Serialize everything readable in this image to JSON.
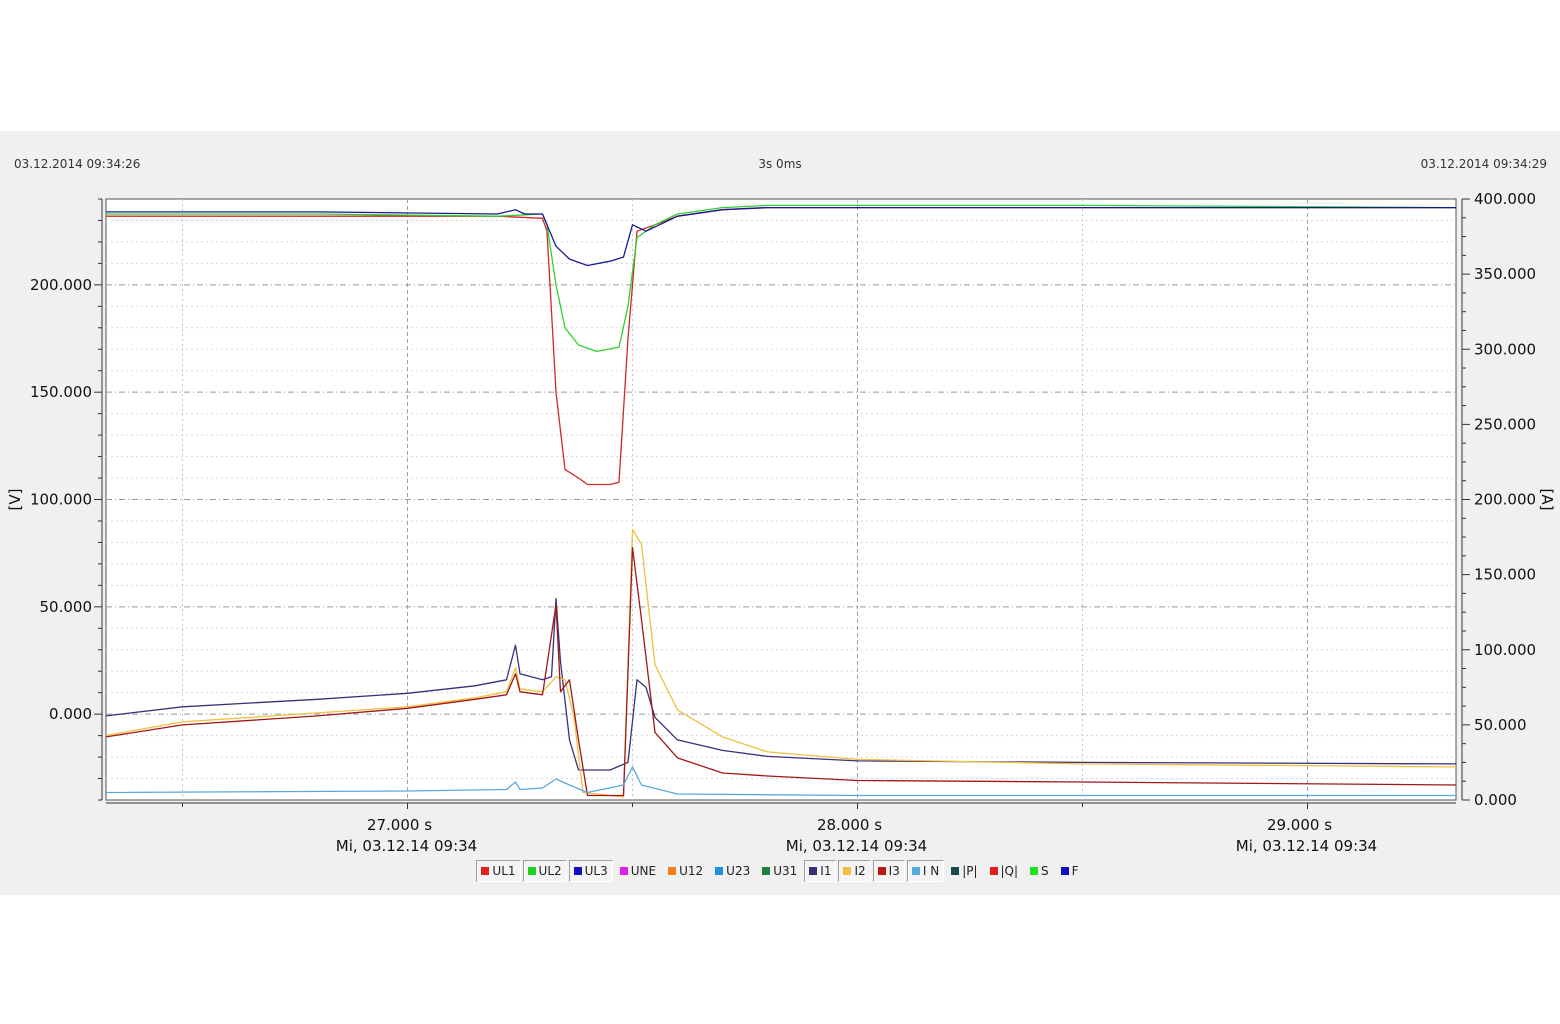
{
  "header": {
    "start_time": "03.12.2014 09:34:26",
    "duration": "3s 0ms",
    "end_time": "03.12.2014 09:34:29"
  },
  "chart_data": {
    "type": "line",
    "title": "",
    "left_axis": {
      "label": "[V]",
      "range": [
        -40,
        240
      ],
      "tick_values": [
        0,
        50,
        100,
        150,
        200
      ],
      "tick_labels": [
        "0.000",
        "50.000",
        "100.000",
        "150.000",
        "200.000"
      ]
    },
    "right_axis": {
      "label": "[A]",
      "range": [
        0,
        400
      ],
      "tick_values": [
        0,
        50,
        100,
        150,
        200,
        250,
        300,
        350,
        400
      ],
      "tick_labels": [
        "0.000",
        "50.000",
        "100.000",
        "150.000",
        "200.000",
        "250.000",
        "300.000",
        "350.000",
        "400.000"
      ]
    },
    "x_axis": {
      "unit": "s",
      "range": [
        26.33,
        29.33
      ],
      "ticks": [
        {
          "value": 27.0,
          "label1": "27.000 s",
          "label2": "Mi, 03.12.14 09:34"
        },
        {
          "value": 28.0,
          "label1": "28.000 s",
          "label2": "Mi, 03.12.14 09:34"
        },
        {
          "value": 29.0,
          "label1": "29.000 s",
          "label2": "Mi, 03.12.14 09:34"
        }
      ],
      "minor_grid": [
        26.5,
        27.5,
        28.5
      ]
    },
    "grid": true,
    "legend_position": "bottom",
    "series": [
      {
        "name": "UL1",
        "axis": "left",
        "color": "#d02828",
        "points": [
          [
            26.33,
            232
          ],
          [
            26.8,
            232
          ],
          [
            27.2,
            232
          ],
          [
            27.3,
            231
          ],
          [
            27.31,
            225
          ],
          [
            27.33,
            150
          ],
          [
            27.35,
            114
          ],
          [
            27.38,
            110
          ],
          [
            27.4,
            107
          ],
          [
            27.45,
            107
          ],
          [
            27.47,
            108
          ],
          [
            27.49,
            175
          ],
          [
            27.51,
            225
          ],
          [
            27.55,
            228
          ],
          [
            27.6,
            232
          ],
          [
            27.7,
            235
          ],
          [
            27.8,
            236
          ],
          [
            28.0,
            236
          ],
          [
            29.33,
            236
          ]
        ]
      },
      {
        "name": "UL2",
        "axis": "left",
        "color": "#30d030",
        "points": [
          [
            26.33,
            233
          ],
          [
            26.8,
            233
          ],
          [
            27.2,
            232
          ],
          [
            27.3,
            233
          ],
          [
            27.31,
            228
          ],
          [
            27.33,
            200
          ],
          [
            27.35,
            180
          ],
          [
            27.38,
            172
          ],
          [
            27.42,
            169
          ],
          [
            27.47,
            171
          ],
          [
            27.49,
            190
          ],
          [
            27.51,
            222
          ],
          [
            27.55,
            228
          ],
          [
            27.6,
            233
          ],
          [
            27.7,
            236
          ],
          [
            27.8,
            237
          ],
          [
            28.0,
            237
          ],
          [
            28.5,
            237
          ],
          [
            29.33,
            236
          ]
        ]
      },
      {
        "name": "UL3",
        "axis": "left",
        "color": "#1a1a90",
        "points": [
          [
            26.33,
            234
          ],
          [
            26.8,
            234
          ],
          [
            27.2,
            233
          ],
          [
            27.24,
            235
          ],
          [
            27.26,
            233
          ],
          [
            27.3,
            233
          ],
          [
            27.31,
            228
          ],
          [
            27.33,
            218
          ],
          [
            27.36,
            212
          ],
          [
            27.4,
            209
          ],
          [
            27.45,
            211
          ],
          [
            27.48,
            213
          ],
          [
            27.5,
            228
          ],
          [
            27.53,
            225
          ],
          [
            27.55,
            227
          ],
          [
            27.6,
            232
          ],
          [
            27.7,
            235
          ],
          [
            27.8,
            236
          ],
          [
            28.0,
            236
          ],
          [
            29.33,
            236
          ]
        ]
      }
    ],
    "current_series": [
      {
        "name": "I1",
        "axis": "right",
        "color": "#3c2f7a",
        "points": [
          [
            26.33,
            56
          ],
          [
            26.5,
            62
          ],
          [
            26.8,
            67
          ],
          [
            27.0,
            71
          ],
          [
            27.15,
            76
          ],
          [
            27.22,
            80
          ],
          [
            27.24,
            103
          ],
          [
            27.25,
            84
          ],
          [
            27.3,
            80
          ],
          [
            27.32,
            82
          ],
          [
            27.33,
            134
          ],
          [
            27.34,
            92
          ],
          [
            27.36,
            40
          ],
          [
            27.38,
            20
          ],
          [
            27.45,
            20
          ],
          [
            27.49,
            25
          ],
          [
            27.51,
            80
          ],
          [
            27.53,
            75
          ],
          [
            27.55,
            55
          ],
          [
            27.6,
            40
          ],
          [
            27.7,
            33
          ],
          [
            27.8,
            29
          ],
          [
            28.0,
            26
          ],
          [
            28.5,
            25
          ],
          [
            29.33,
            24
          ]
        ]
      },
      {
        "name": "I2",
        "axis": "right",
        "color": "#f0c040",
        "points": [
          [
            26.33,
            43
          ],
          [
            26.5,
            52
          ],
          [
            26.8,
            58
          ],
          [
            27.0,
            62
          ],
          [
            27.15,
            68
          ],
          [
            27.22,
            72
          ],
          [
            27.24,
            88
          ],
          [
            27.25,
            74
          ],
          [
            27.3,
            72
          ],
          [
            27.33,
            82
          ],
          [
            27.35,
            80
          ],
          [
            27.37,
            55
          ],
          [
            27.39,
            5
          ],
          [
            27.48,
            2
          ],
          [
            27.5,
            180
          ],
          [
            27.52,
            170
          ],
          [
            27.55,
            90
          ],
          [
            27.6,
            60
          ],
          [
            27.7,
            42
          ],
          [
            27.8,
            32
          ],
          [
            28.0,
            27
          ],
          [
            28.5,
            24
          ],
          [
            29.33,
            22
          ]
        ]
      },
      {
        "name": "I3",
        "axis": "right",
        "color": "#a01818",
        "points": [
          [
            26.33,
            42
          ],
          [
            26.5,
            50
          ],
          [
            26.8,
            56
          ],
          [
            27.0,
            61
          ],
          [
            27.15,
            67
          ],
          [
            27.22,
            70
          ],
          [
            27.24,
            84
          ],
          [
            27.25,
            72
          ],
          [
            27.3,
            70
          ],
          [
            27.33,
            130
          ],
          [
            27.34,
            72
          ],
          [
            27.36,
            80
          ],
          [
            27.38,
            40
          ],
          [
            27.4,
            3
          ],
          [
            27.48,
            3
          ],
          [
            27.5,
            168
          ],
          [
            27.52,
            120
          ],
          [
            27.55,
            45
          ],
          [
            27.6,
            28
          ],
          [
            27.7,
            18
          ],
          [
            27.8,
            16
          ],
          [
            28.0,
            13
          ],
          [
            28.5,
            12
          ],
          [
            29.33,
            10
          ]
        ]
      },
      {
        "name": "I N",
        "axis": "right",
        "color": "#5aa8e0",
        "points": [
          [
            26.33,
            5
          ],
          [
            27.0,
            6
          ],
          [
            27.22,
            7
          ],
          [
            27.24,
            12
          ],
          [
            27.25,
            7
          ],
          [
            27.3,
            8
          ],
          [
            27.33,
            14
          ],
          [
            27.36,
            10
          ],
          [
            27.4,
            5
          ],
          [
            27.48,
            10
          ],
          [
            27.5,
            22
          ],
          [
            27.52,
            10
          ],
          [
            27.6,
            4
          ],
          [
            28.0,
            3
          ],
          [
            29.33,
            3
          ]
        ]
      }
    ]
  },
  "legend": [
    {
      "label": "UL1",
      "color": "#e02020",
      "active": true
    },
    {
      "label": "UL2",
      "color": "#20d020",
      "active": true
    },
    {
      "label": "UL3",
      "color": "#1010c0",
      "active": true
    },
    {
      "label": "UNE",
      "color": "#e020e0",
      "active": false
    },
    {
      "label": "U12",
      "color": "#f08020",
      "active": false
    },
    {
      "label": "U23",
      "color": "#2090e0",
      "active": false
    },
    {
      "label": "U31",
      "color": "#208040",
      "active": false
    },
    {
      "label": "I1",
      "color": "#3c2f7a",
      "active": true
    },
    {
      "label": "I2",
      "color": "#f0c040",
      "active": true
    },
    {
      "label": "I3",
      "color": "#c01818",
      "active": true
    },
    {
      "label": "I N",
      "color": "#5aa8e0",
      "active": true
    },
    {
      "label": "|P|",
      "color": "#1a4a4a",
      "active": false
    },
    {
      "label": "|Q|",
      "color": "#e02020",
      "active": false
    },
    {
      "label": "S",
      "color": "#20e020",
      "active": false
    },
    {
      "label": "F",
      "color": "#1010c0",
      "active": false
    }
  ]
}
